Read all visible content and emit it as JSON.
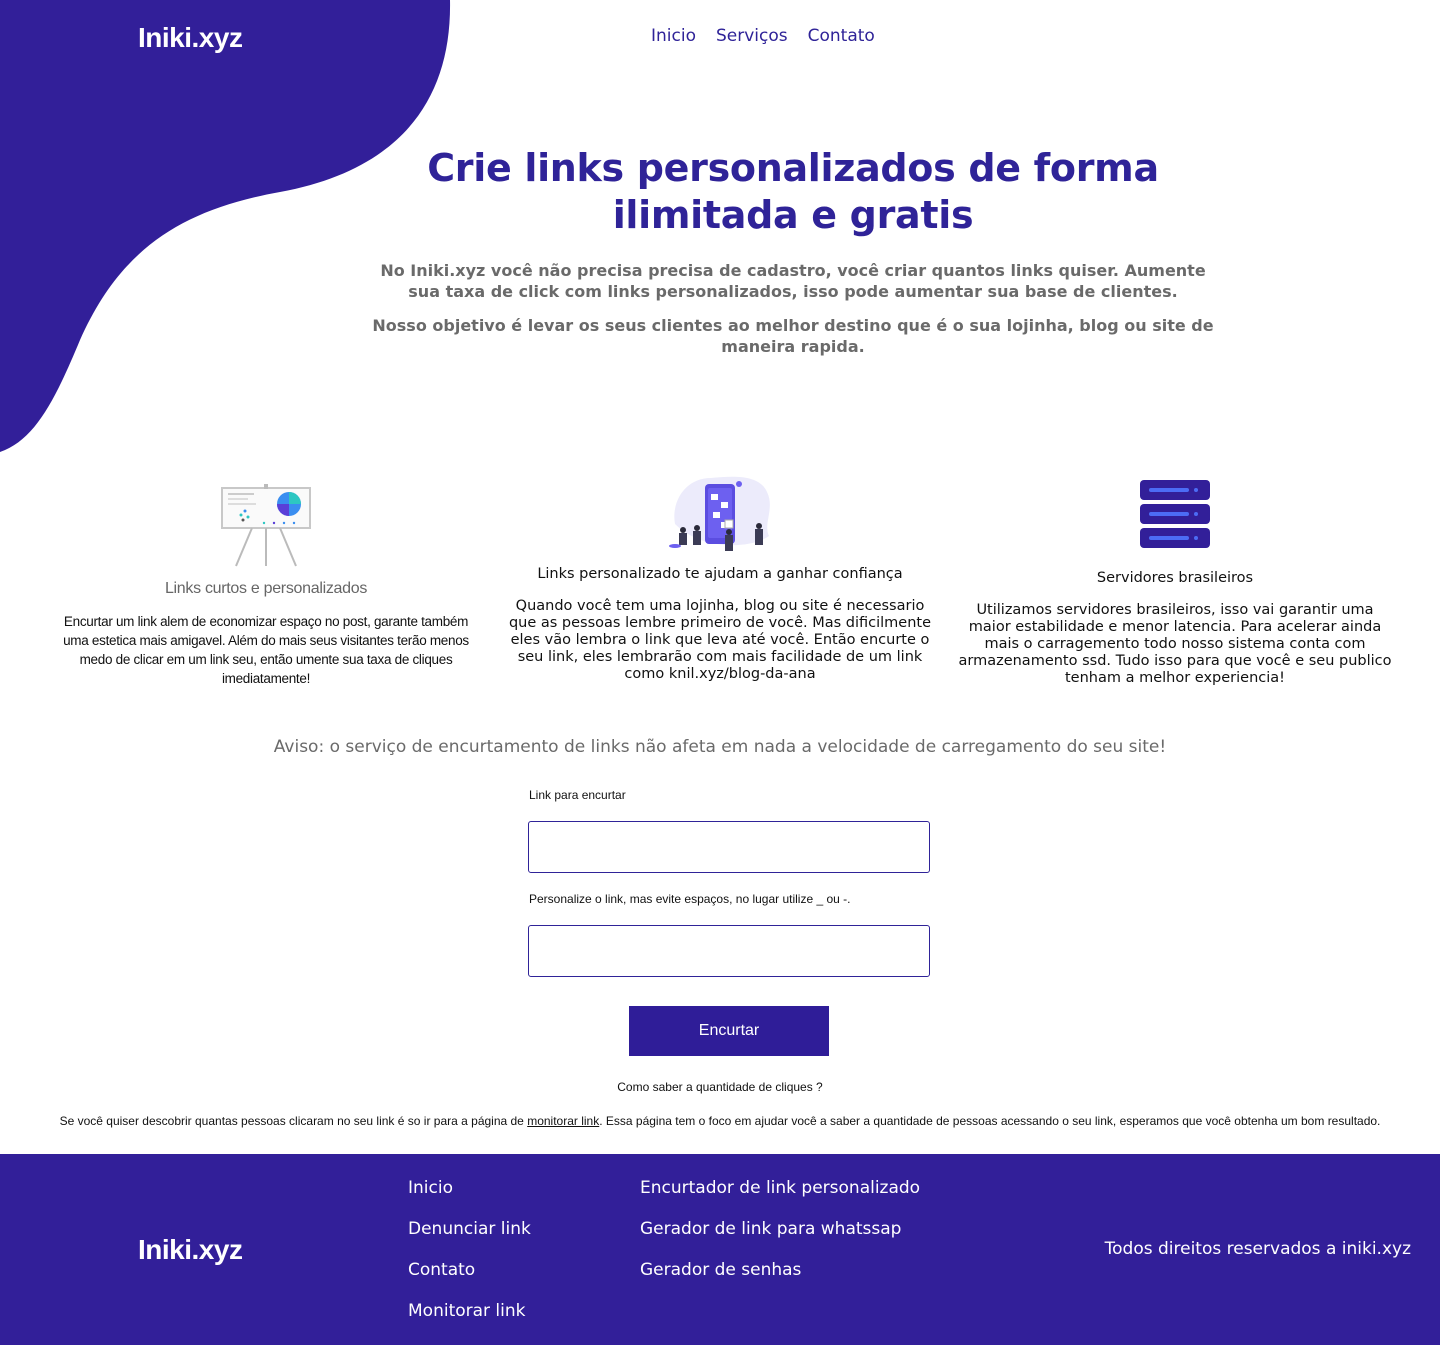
{
  "brand": {
    "logo": "Iniki.xyz",
    "accent": "#321f99"
  },
  "nav": {
    "items": [
      "Inicio",
      "Serviços",
      "Contato"
    ]
  },
  "hero": {
    "title": "Crie links personalizados de forma ilimitada e gratis",
    "p1": "No Iniki.xyz você não precisa precisa de cadastro, você criar quantos links quiser. Aumente sua taxa de click com links personalizados, isso pode aumentar sua base de clientes.",
    "p2": "Nosso objetivo é levar os seus clientes ao melhor destino que é o sua lojinha, blog ou site de maneira rapida."
  },
  "features": [
    {
      "icon": "presentation-chart-illustration",
      "title": "Links curtos e personalizados",
      "text": "Encurtar um link alem de economizar espaço no post, garante também uma estetica mais amigavel. Além do mais seus visitantes terão menos medo de clicar em um link seu, então umente sua taxa de cliques imediatamente!"
    },
    {
      "icon": "phone-team-illustration",
      "title": "Links personalizado te ajudam a ganhar confiança",
      "text": "Quando você tem uma lojinha, blog ou site é necessario que as pessoas lembre primeiro de você. Mas dificilmente eles vão lembra o link que leva até você. Então encurte o seu link, eles lembrarão com mais facilidade de um link como knil.xyz/blog-da-ana"
    },
    {
      "icon": "server-stack-icon",
      "title": "Servidores brasileiros",
      "text": "Utilizamos servidores brasileiros, isso vai garantir uma maior estabilidade e menor latencia. Para acelerar ainda mais o carragemento todo nosso sistema conta com armazenamento ssd.  Tudo isso para que você e seu publico tenham a melhor experiencia!"
    }
  ],
  "notice": "Aviso: o serviço de encurtamento de links não afeta em nada a velocidade de carregamento do seu site!",
  "form": {
    "link_label": "Link para encurtar",
    "link_value": "",
    "custom_label": "Personalize o link, mas evite espaços, no lugar utilize _ ou -.",
    "custom_value": "",
    "submit": "Encurtar"
  },
  "clicks": {
    "question": "Como saber a quantidade de cliques ?",
    "before": "Se você quiser descobrir quantas pessoas clicaram no seu link é so ir para a página de ",
    "link": "monitorar link",
    "after": ". Essa página tem o foco em ajudar você a saber a quantidade de pessoas acessando o seu link, esperamos que você obtenha um bom resultado."
  },
  "footer": {
    "logo": "Iniki.xyz",
    "col1": [
      "Inicio",
      "Denunciar link",
      "Contato",
      "Monitorar link"
    ],
    "col2": [
      "Encurtador de link personalizado",
      "Gerador de link para whatssap",
      "Gerador de senhas"
    ],
    "rights": "Todos direitos reservados a iniki.xyz"
  }
}
